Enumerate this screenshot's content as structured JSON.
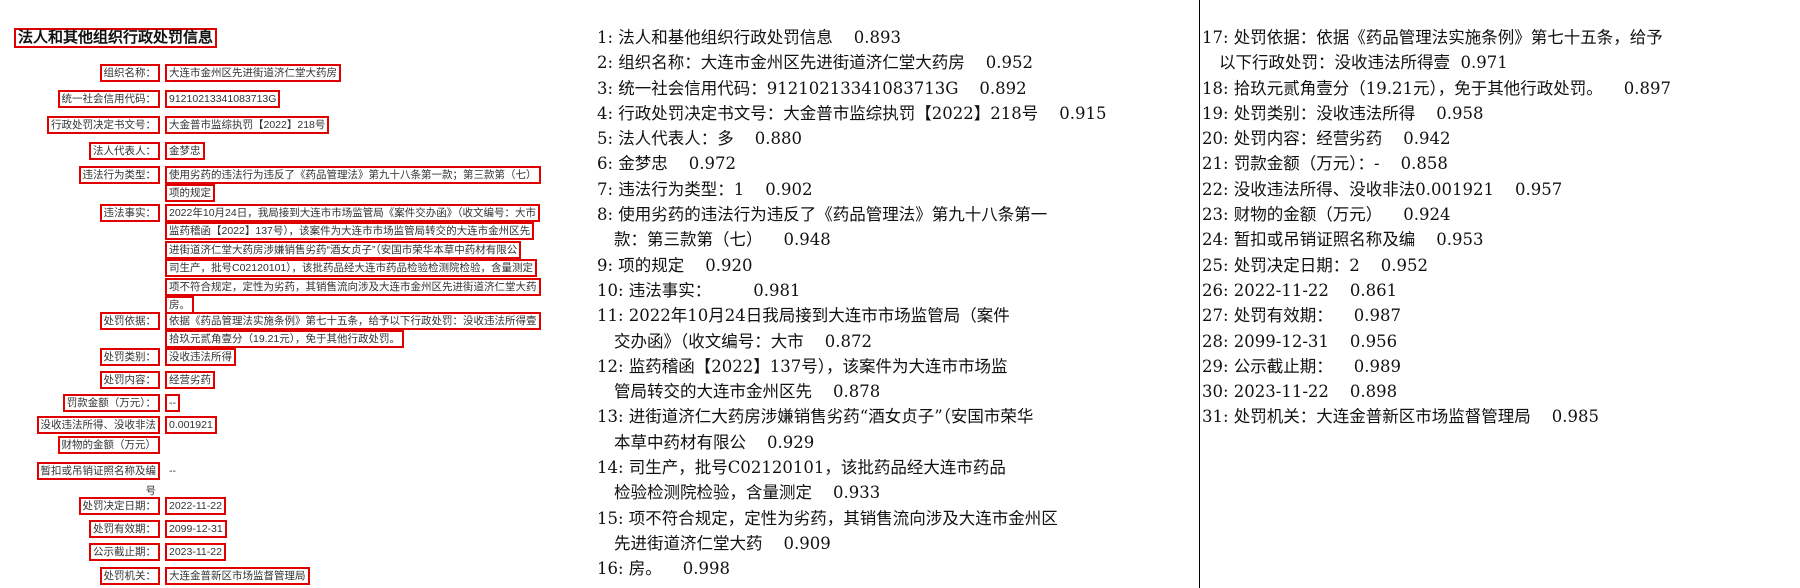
{
  "document": {
    "title": "法人和其他组织行政处罚信息",
    "rows": [
      {
        "label": "组织名称：",
        "values": [
          "大连市金州区先进街道济仁堂大药房"
        ]
      },
      {
        "label": "统一社会信用代码：",
        "values": [
          "91210213341083713G"
        ]
      },
      {
        "label": "行政处罚决定书文号：",
        "values": [
          "大金普市监综执罚【2022】218号"
        ]
      },
      {
        "label": "法人代表人：",
        "values": [
          "金梦忠"
        ]
      },
      {
        "label": "违法行为类型：",
        "values": [
          "使用劣药的违法行为违反了《药品管理法》第九十八条第一款；第三款第（七）",
          "项的规定"
        ]
      },
      {
        "label": "违法事实：",
        "values": [
          "2022年10月24日，我局接到大连市市场监管局《案件交办函》（收文编号：大市",
          "监药稽函【2022】137号），该案件为大连市市场监管局转交的大连市金州区先",
          "进街道济仁堂大药房涉嫌销售劣药“酒女贞子”（安国市荣华本草中药材有限公",
          "司生产，批号C02120101），该批药品经大连市药品检验检测院检验，含量测定",
          "项不符合规定，定性为劣药，其销售流向涉及大连市金州区先进街道济仁堂大药",
          "房。"
        ]
      },
      {
        "label": "处罚依据：",
        "values": [
          "依据《药品管理法实施条例》第七十五条，给予以下行政处罚：没收违法所得壹",
          "拾玖元贰角壹分（19.21元），免于其他行政处罚。"
        ]
      },
      {
        "label": "处罚类别：",
        "values": [
          "没收违法所得"
        ]
      },
      {
        "label": "处罚内容：",
        "values": [
          "经营劣药"
        ]
      },
      {
        "label": "罚款金额（万元）：",
        "values": [
          "--"
        ]
      },
      {
        "label": "没收违法所得、没收非法",
        "label2": "财物的金额（万元）",
        "values": [
          "0.001921"
        ]
      },
      {
        "label": "暂扣或吊销证照名称及编",
        "label2": "号",
        "values": [
          "--"
        ],
        "plain": true
      },
      {
        "label": "处罚决定日期：",
        "values": [
          "2022-11-22"
        ]
      },
      {
        "label": "处罚有效期：",
        "values": [
          "2099-12-31"
        ]
      },
      {
        "label": "公示截止期：",
        "values": [
          "2023-11-22"
        ]
      },
      {
        "label": "处罚机关：",
        "values": [
          "大连金普新区市场监督管理局"
        ]
      }
    ]
  },
  "ocr_middle": [
    {
      "lines": [
        "1: 法人和基他组织行政处罚信息    0.893"
      ]
    },
    {
      "lines": [
        "2: 组织名称：大连市金州区先进街道济仁堂大药房    0.952"
      ]
    },
    {
      "lines": [
        "3: 统一社会信用代码：91210213341083713G    0.892"
      ]
    },
    {
      "lines": [
        "4: 行政处罚决定书文号：大金普市监综执罚【2022】218号    0.915"
      ]
    },
    {
      "lines": [
        "5: 法人代表人：多    0.880"
      ]
    },
    {
      "lines": [
        "6: 金梦忠    0.972"
      ]
    },
    {
      "lines": [
        "7: 违法行为类型：1    0.902"
      ]
    },
    {
      "lines": [
        "8: 使用劣药的违法行为违反了《药品管理法》第九十八条第一",
        "款：第三款第（七）    0.948"
      ]
    },
    {
      "lines": [
        "9: 项的规定    0.920"
      ]
    },
    {
      "lines": [
        "10: 违法事实：        0.981"
      ]
    },
    {
      "lines": [
        "11: 2022年10月24日我局接到大连市市场监管局（案件",
        "交办函》（收文编号：大市    0.872"
      ]
    },
    {
      "lines": [
        "12: 监药稽函【2022】137号），该案件为大连市市场监",
        "管局转交的大连市金州区先    0.878"
      ]
    },
    {
      "lines": [
        "13: 进街道济仁大药房涉嫌销售劣药“酒女贞子”（安国市荣华",
        "本草中药材有限公    0.929"
      ]
    },
    {
      "lines": [
        "14: 司生产，批号C02120101，该批药品经大连市药品",
        "检验检测院检验，含量测定    0.933"
      ]
    },
    {
      "lines": [
        "15: 项不符合规定，定性为劣药，其销售流向涉及大连市金州区",
        "先进街道济仁堂大药    0.909"
      ]
    },
    {
      "lines": [
        "16: 房。    0.998"
      ]
    }
  ],
  "ocr_right": [
    {
      "lines": [
        "17: 处罚依据：依据《药品管理法实施条例》第七十五条，给予",
        "以下行政处罚：没收违法所得壹  0.971"
      ]
    },
    {
      "lines": [
        "18: 拾玖元贰角壹分（19.21元），免于其他行政处罚。    0.897"
      ]
    },
    {
      "lines": [
        "19: 处罚类别：没收违法所得    0.958"
      ]
    },
    {
      "lines": [
        "20: 处罚内容：经营劣药    0.942"
      ]
    },
    {
      "lines": [
        "21: 罚款金额（万元）：-    0.858"
      ]
    },
    {
      "lines": [
        "22: 没收违法所得、没收非法0.001921    0.957"
      ]
    },
    {
      "lines": [
        "23: 财物的金额（万元）    0.924"
      ]
    },
    {
      "lines": [
        "24: 暂扣或吊销证照名称及编    0.953"
      ]
    },
    {
      "lines": [
        "25: 处罚决定日期：2    0.952"
      ]
    },
    {
      "lines": [
        "26: 2022-11-22    0.861"
      ]
    },
    {
      "lines": [
        "27: 处罚有效期：    0.987"
      ]
    },
    {
      "lines": [
        "28: 2099-12-31    0.956"
      ]
    },
    {
      "lines": [
        "29: 公示截止期：    0.989"
      ]
    },
    {
      "lines": [
        "30: 2023-11-22    0.898"
      ]
    },
    {
      "lines": [
        "31: 处罚机关：大连金普新区市场监督管理局    0.985"
      ]
    }
  ],
  "colors": {
    "box": "#e00000",
    "text": "#111111"
  }
}
